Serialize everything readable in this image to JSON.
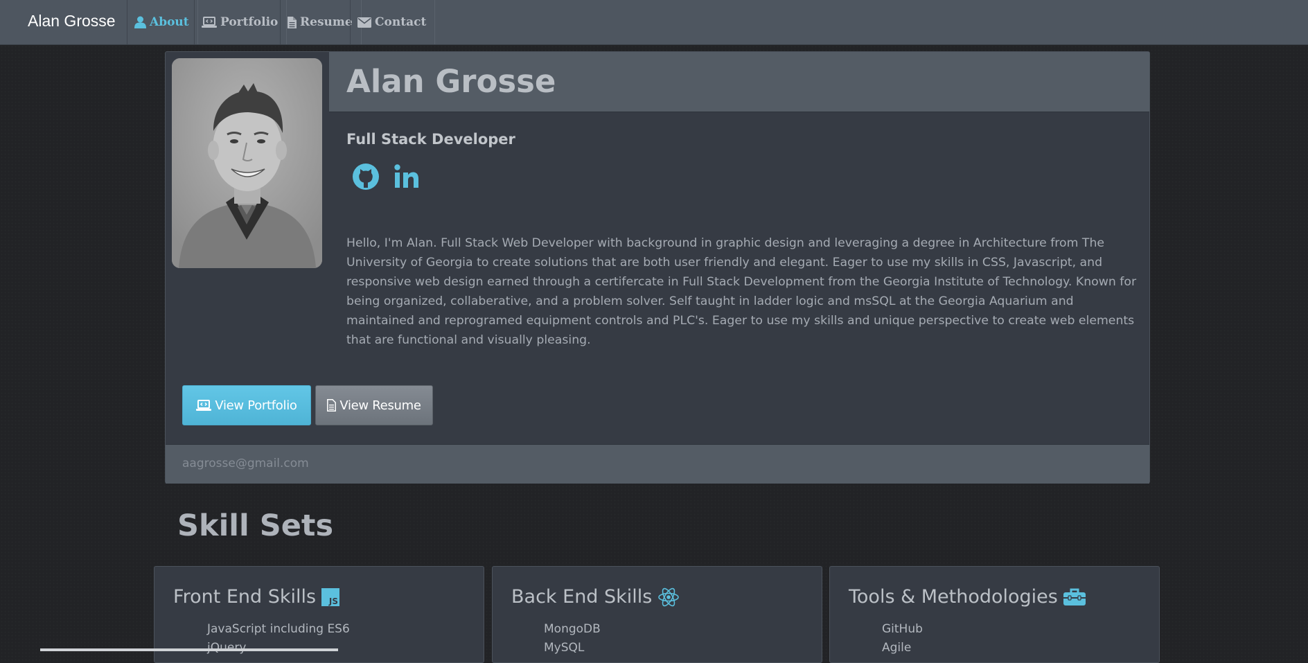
{
  "navbar": {
    "brand": "Alan Grosse",
    "items": [
      {
        "label": "About",
        "icon": "user-icon",
        "active": true
      },
      {
        "label": "Portfolio",
        "icon": "laptop-code-icon",
        "active": false
      },
      {
        "label": "Resume",
        "icon": "file-icon",
        "active": false
      },
      {
        "label": "Contact",
        "icon": "envelope-icon",
        "active": false
      }
    ]
  },
  "profile": {
    "name": "Alan Grosse",
    "title": "Full Stack Developer",
    "photo_alt": "portrait photo",
    "social": [
      {
        "name": "github-icon"
      },
      {
        "name": "linkedin-icon"
      }
    ],
    "bio": "Hello, I'm Alan. Full Stack Web Developer with background in graphic design and leveraging a degree in Architecture from The University of Georgia to create solutions that are both user friendly and elegant. Eager to use my skills in CSS, Javascript, and responsive web design earned through a certifercate in Full Stack Development from the Georgia Institute of Technology. Known for being organized, collaberative, and a problem solver. Self taught in ladder logic and msSQL at the Georgia Aquarium and maintained and reprogramed equipment controls and PLC's. Eager to use my skills and unique perspective to create web elements that are functional and visually pleasing.",
    "buttons": {
      "portfolio": "View Portfolio",
      "resume": "View Resume"
    },
    "email": "aagrosse@gmail.com"
  },
  "skills": {
    "heading": "Skill Sets",
    "cards": [
      {
        "title": "Front End Skills",
        "icon": "js-icon",
        "items": [
          "JavaScript including ES6",
          "jQuery"
        ]
      },
      {
        "title": "Back End Skills",
        "icon": "react-icon",
        "items": [
          "MongoDB",
          "MySQL"
        ]
      },
      {
        "title": "Tools & Methodologies",
        "icon": "toolbox-icon",
        "items": [
          "GitHub",
          "Agile"
        ]
      }
    ]
  },
  "colors": {
    "accent": "#5bc0de",
    "navbar": "#4e5660",
    "card": "#363b44",
    "background": "#222326"
  }
}
